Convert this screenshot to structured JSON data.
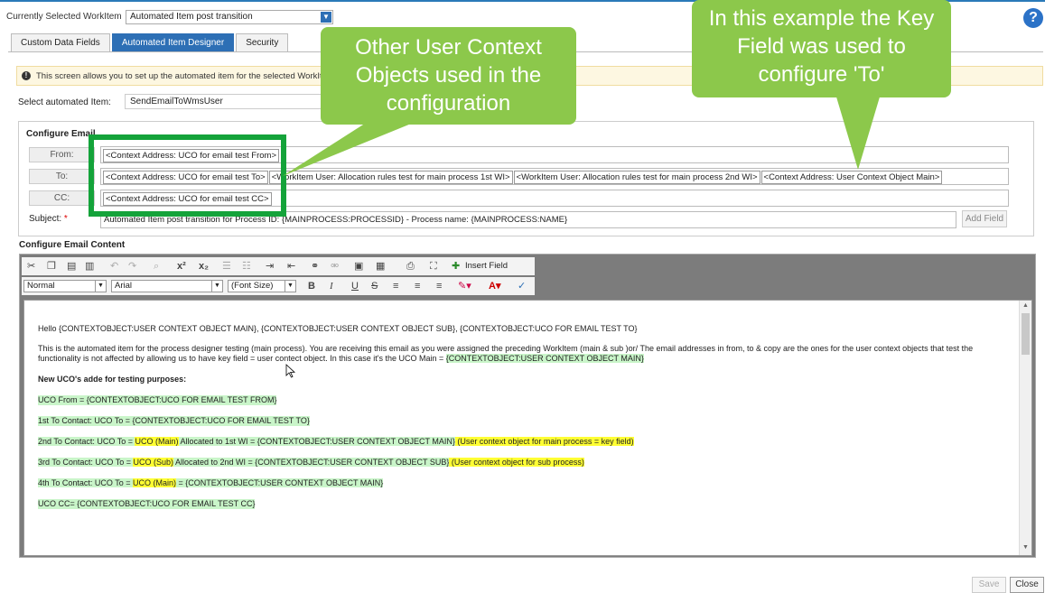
{
  "header": {
    "workitem_label": "Currently Selected WorkItem",
    "workitem_value": "Automated Item post transition",
    "help_icon": "?"
  },
  "tabs": [
    "Custom Data Fields",
    "Automated Item Designer",
    "Security"
  ],
  "info": {
    "icon": "!",
    "text": "This screen allows you to set up the automated item for the selected WorkIte"
  },
  "select_item": {
    "label": "Select automated Item:",
    "value": "SendEmailToWmsUser"
  },
  "configure_email": {
    "title": "Configure Email",
    "from_label": "From:",
    "from_chips": [
      "<Context Address: UCO for email test From>"
    ],
    "to_label": "To:",
    "to_chips": [
      "<Context Address: UCO for email test To>",
      "<WorkItem User: Allocation rules test for main process 1st WI>",
      "<WorkItem User: Allocation rules test for main process 2nd WI>",
      "<Context Address: User Context Object Main>"
    ],
    "cc_label": "CC:",
    "cc_chips": [
      "<Context Address: UCO for email test CC>"
    ],
    "subject_label": "Subject:",
    "subject_required": "*",
    "subject_value": "Automated Item post transition for Process ID:  {MAINPROCESS:PROCESSID} - Process name:  {MAINPROCESS:NAME}",
    "add_field": "Add Field"
  },
  "content": {
    "title": "Configure Email Content",
    "insert_field": "Insert Field",
    "format_value": "Normal",
    "font_value": "Arial",
    "size_value": "(Font Size)",
    "body": {
      "p1": "Hello {CONTEXTOBJECT:USER CONTEXT OBJECT MAIN}, {CONTEXTOBJECT:USER CONTEXT OBJECT SUB}, {CONTEXTOBJECT:UCO FOR EMAIL TEST TO}",
      "p2_line1": "This is the automated item for the process designer testing (main process). You are receiving this email as you were assigned the preceding WorkItem (main & sub )or/ The email addresses in from, to & copy are the ones for the user context objects that test the",
      "p2_line2": "functionality is not affected by allowing us to have key field = user contect object. In this case it's the UCO Main = ",
      "p2_line2_hl": "{CONTEXTOBJECT:USER CONTEXT OBJECT MAIN}",
      "p3": "New UCO's adde for testing purposes:",
      "p4": "UCO From = {CONTEXTOBJECT:UCO FOR EMAIL TEST FROM}",
      "p5": "1st To Contact: UCO To = {CONTEXTOBJECT:UCO FOR EMAIL TEST TO}",
      "p6_a": "2nd To Contact: UCO To = ",
      "p6_b": "UCO (Main)",
      "p6_c": " Allocated to 1st WI = {CONTEXTOBJECT:USER CONTEXT OBJECT MAIN}",
      "p6_d": " (User context object for main process = key field)",
      "p7_a": "3rd To Contact: UCO To = ",
      "p7_b": "UCO (Sub)",
      "p7_c": " Allocated to 2nd WI = {CONTEXTOBJECT:USER CONTEXT OBJECT SUB}",
      "p7_d": " (User context object for sub process)",
      "p8_a": "4th To Contact: UCO To = ",
      "p8_b": "UCO (Main)",
      "p8_c": " = {CONTEXTOBJECT:USER CONTEXT OBJECT MAIN}",
      "p9": "UCO CC= {CONTEXTOBJECT:UCO FOR EMAIL TEST CC}"
    }
  },
  "footer": {
    "save": "Save",
    "close": "Close"
  },
  "callouts": {
    "left": "Other User Context Objects used in the configuration",
    "right": "In this example the Key Field was used to configure 'To'"
  },
  "colors": {
    "accent": "#2d6fb5",
    "callout_green": "#8cc84b",
    "box_green": "#14a33a",
    "highlight_green": "#c9f5c9",
    "highlight_yellow": "#ffff33"
  }
}
